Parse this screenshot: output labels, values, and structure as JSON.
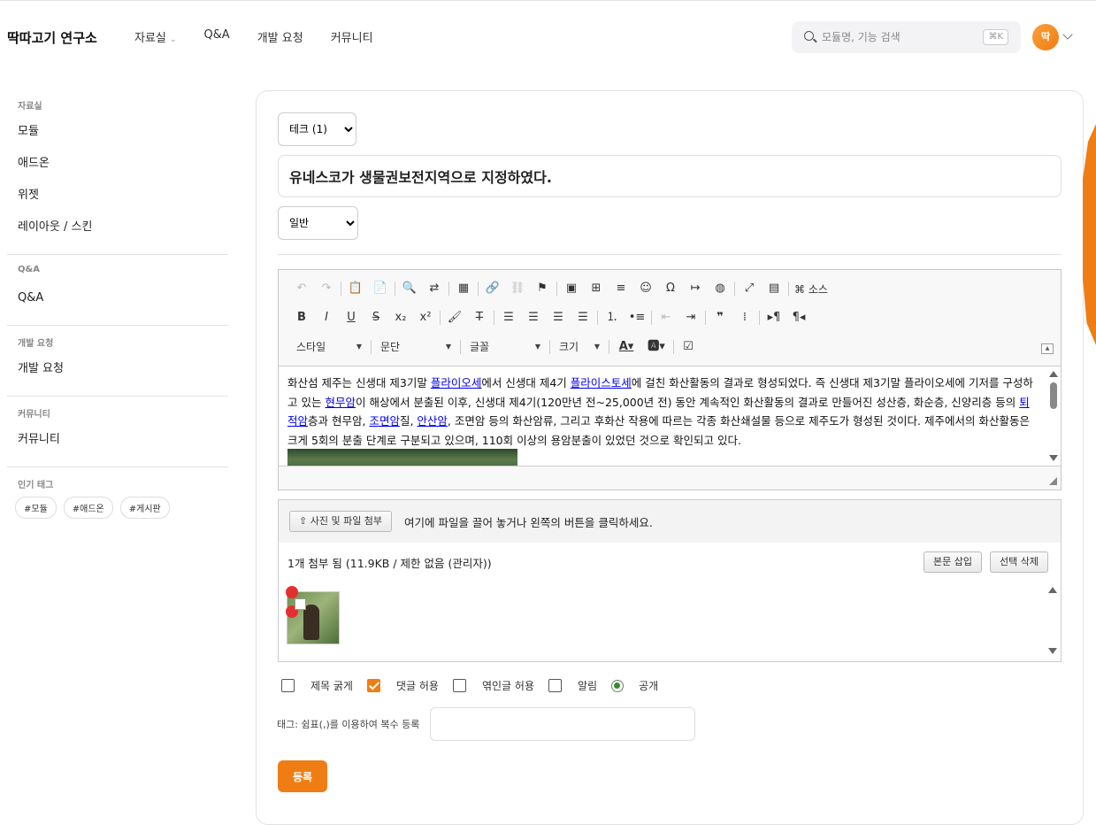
{
  "brand": "딱따고기 연구소",
  "nav": {
    "archive": "자료실",
    "qa": "Q&A",
    "dev_request": "개발 요청",
    "community": "커뮤니티"
  },
  "search": {
    "placeholder": "모듈명, 기능 검색",
    "shortcut": "⌘K"
  },
  "avatar_initial": "딱",
  "sidebar": {
    "archive": {
      "title": "자료실",
      "items": [
        "모듈",
        "애드온",
        "위젯",
        "레이아웃 / 스킨"
      ]
    },
    "qa": {
      "title": "Q&A",
      "items": [
        "Q&A"
      ]
    },
    "dev": {
      "title": "개발 요청",
      "items": [
        "개발 요청"
      ]
    },
    "community": {
      "title": "커뮤니티",
      "items": [
        "커뮤니티"
      ]
    },
    "tags": {
      "title": "인기 태그",
      "items": [
        "#모듈",
        "#애드온",
        "#게시판"
      ]
    }
  },
  "form": {
    "category": "테크 (1)",
    "title": "유네스코가 생물권보전지역으로 지정하였다.",
    "doc_type": "일반",
    "toolbar": {
      "source_label": "소스",
      "style": "스타일",
      "paragraph": "문단",
      "font": "글꼴",
      "size": "크기"
    },
    "body": {
      "t1": "화산섬 제주는 신생대 제3기말 ",
      "l1": "플라이오세",
      "t2": "에서 신생대 제4기 ",
      "l2": "플라이스토세",
      "t3": "에 걸친 화산활동의 결과로 형성되었다. 즉 신생대 제3기말 플라이오세에 기저를 구성하고 있는 ",
      "l3": "현무암",
      "t4": "이 해상에서 분출된 이후, 신생대 제4기(120만년 전~25,000년 전) 동안 계속적인 화산활동의 결과로 만들어진 성산층, 화순층, 신양리층 등의 ",
      "l4": "퇴적암",
      "t5": "층과 현무암, ",
      "l5": "조면암",
      "t6": "질, ",
      "l6": "안산암",
      "t7": ", 조면암 등의 화산암류, 그리고 후화산 작용에 따르는 각종 화산쇄설물 등으로 제주도가 형성된 것이다. 제주에서의 화산활동은 크게 5회의 분출 단계로 구분되고 있으며, 110회 이상의 용암분출이 있었던 것으로 확인되고 있다."
    },
    "attach": {
      "button": "사진 및 파일 첨부",
      "drop_text": "여기에 파일을 끌어 놓거나 왼쪽의 버튼을 클릭하세요.",
      "info": "1개 첨부 됨 (11.9KB / 제한 없음 (관리자))",
      "insert": "본문 삽입",
      "delete": "선택 삭제"
    },
    "options": {
      "bold_title": "제목 굵게",
      "allow_comment": "댓글 허용",
      "allow_trackback": "엮인글 허용",
      "notify": "알림",
      "public": "공개"
    },
    "tag_label": "태그: 쉼표(,)를 이용하여 복수 등록",
    "submit": "등록"
  },
  "colors": {
    "accent": "#f07d14",
    "link": "#0000ee"
  }
}
